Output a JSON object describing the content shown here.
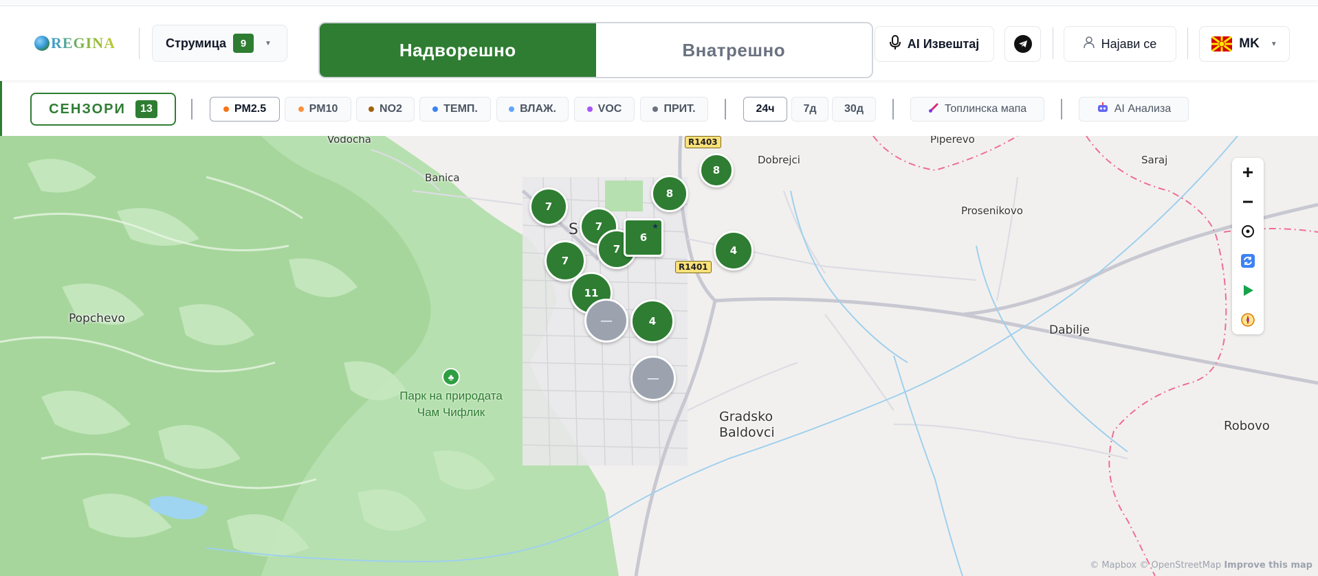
{
  "header": {
    "logo_text": "REGINA",
    "city": {
      "name": "Струмица",
      "count": "9"
    },
    "mode": {
      "outdoor": "Надворешно",
      "indoor": "Внатрешно",
      "active": "outdoor"
    },
    "ai_report": "AI Извештај",
    "login": "Најави се",
    "lang": "MK",
    "icons": {
      "mic": "microphone-icon",
      "telegram": "telegram-icon",
      "user": "user-icon",
      "flag": "macedonia-flag-icon"
    }
  },
  "filters": {
    "sensors_label": "СЕНЗОРИ",
    "sensors_count": "13",
    "pollutants": [
      {
        "label": "PM2.5",
        "color": "#f97316",
        "active": true
      },
      {
        "label": "PM10",
        "color": "#fb923c",
        "active": false
      },
      {
        "label": "NO2",
        "color": "#a16207",
        "active": false
      },
      {
        "label": "ТЕМП.",
        "color": "#3b82f6",
        "active": false
      },
      {
        "label": "ВЛАЖ.",
        "color": "#60a5fa",
        "active": false
      },
      {
        "label": "VOC",
        "color": "#a855f7",
        "active": false
      },
      {
        "label": "ПРИТ.",
        "color": "#6b7280",
        "active": false
      }
    ],
    "periods": [
      {
        "label": "24ч",
        "active": true
      },
      {
        "label": "7д",
        "active": false
      },
      {
        "label": "30д",
        "active": false
      }
    ],
    "heatmap": "Топлинска мапа",
    "ai_analysis": "AI Анализа"
  },
  "map": {
    "places": {
      "vodocha": "Vodocha",
      "banica": "Banica",
      "dobrejci": "Dobrejci",
      "piperevo": "Piperevo",
      "saraj": "Saraj",
      "prosenikovo": "Prosenikovo",
      "popchevo": "Popchevo",
      "dabilje": "Dabilje",
      "gradsko": "Gradsko",
      "baldovci": "Baldovci",
      "robovo": "Robovo",
      "strumica_partial": "S"
    },
    "park_line1": "Парк на природата",
    "park_line2": "Чам Чифлик",
    "roads": {
      "r1403": "R1403",
      "r1401": "R1401"
    },
    "markers": [
      "8",
      "8",
      "7",
      "7",
      "7",
      "6",
      "4",
      "7",
      "11",
      "—",
      "4",
      "—"
    ],
    "controls": [
      "zoom-in-icon",
      "zoom-out-icon",
      "locate-icon",
      "refresh-icon",
      "play-icon",
      "compass-icon"
    ],
    "attribution": "© Mapbox © OpenStreetMap",
    "improve": "Improve this map"
  }
}
